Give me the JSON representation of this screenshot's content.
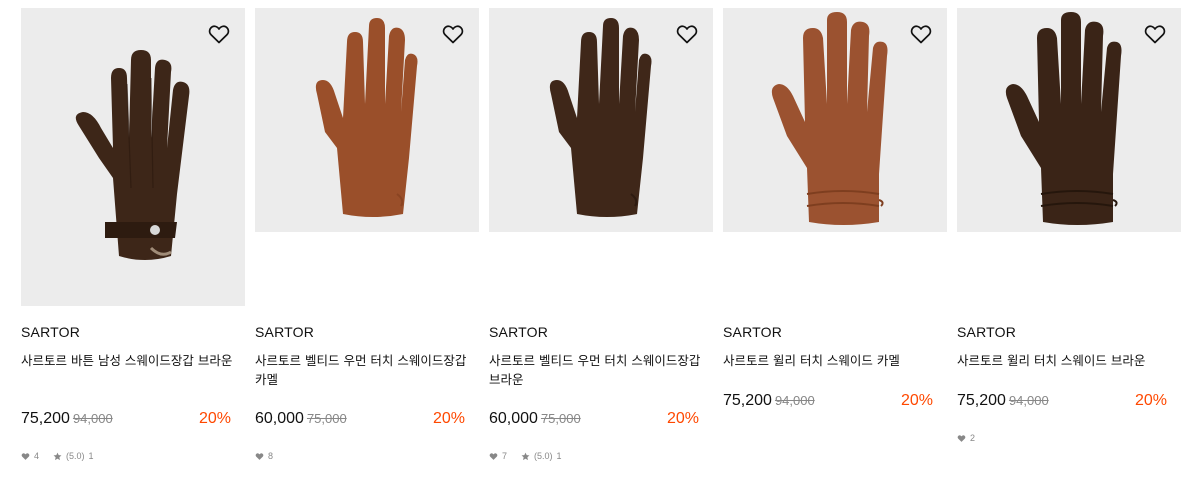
{
  "products": [
    {
      "brand": "SARTOR",
      "name": "사르토르 바튼 남성 스웨이드장갑 브라운",
      "price": "75,200",
      "original_price": "94,000",
      "discount": "20%",
      "likes": "4",
      "rating": "(5.0)",
      "reviews": "1",
      "color": "#3d2618"
    },
    {
      "brand": "SARTOR",
      "name": "사르토르 벨티드 우먼 터치 스웨이드장갑 카멜",
      "price": "60,000",
      "original_price": "75,000",
      "discount": "20%",
      "likes": "8",
      "color": "#9a4f2a"
    },
    {
      "brand": "SARTOR",
      "name": "사르토르 벨티드 우먼 터치 스웨이드장갑 브라운",
      "price": "60,000",
      "original_price": "75,000",
      "discount": "20%",
      "likes": "7",
      "rating": "(5.0)",
      "reviews": "1",
      "color": "#3f2719"
    },
    {
      "brand": "SARTOR",
      "name": "사르토르 윌리 터치 스웨이드 카멜",
      "price": "75,200",
      "original_price": "94,000",
      "discount": "20%",
      "color": "#9b5230"
    },
    {
      "brand": "SARTOR",
      "name": "사르토르 윌리 터치 스웨이드 브라운",
      "price": "75,200",
      "original_price": "94,000",
      "discount": "20%",
      "likes": "2",
      "color": "#3a2417"
    }
  ],
  "icons": {
    "wishlist": "heart-outline-icon",
    "like": "heart-filled-icon",
    "rating": "star-icon"
  },
  "colors": {
    "discount": "#ff4800",
    "thumb_bg": "#ececec",
    "meta": "#888888"
  }
}
